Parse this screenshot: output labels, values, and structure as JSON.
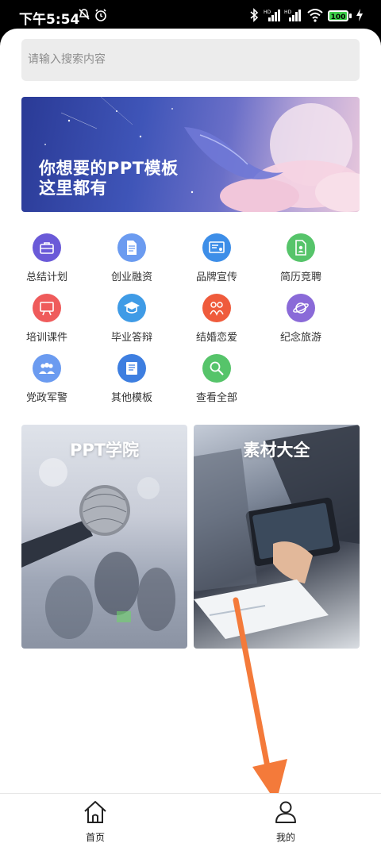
{
  "status_bar": {
    "time": "下午5:54",
    "battery": "100",
    "icons": [
      "mute-icon",
      "alarm-icon",
      "bluetooth-icon",
      "signal-icon",
      "signal-icon",
      "wifi-icon",
      "battery-icon",
      "charging-icon"
    ]
  },
  "search": {
    "placeholder": "请输入搜索内容"
  },
  "banner": {
    "title": "你想要的PPT模板\n这里都有"
  },
  "categories": [
    {
      "label": "总结计划",
      "icon": "briefcase-icon",
      "color": "#6a5ad8"
    },
    {
      "label": "创业融资",
      "icon": "document-icon",
      "color": "#6b9bf0"
    },
    {
      "label": "品牌宣传",
      "icon": "certificate-icon",
      "color": "#3d8ee8"
    },
    {
      "label": "简历竞聘",
      "icon": "resume-icon",
      "color": "#56c46a"
    },
    {
      "label": "培训课件",
      "icon": "presentation-icon",
      "color": "#ef5b5b"
    },
    {
      "label": "毕业答辩",
      "icon": "graduation-cap-icon",
      "color": "#3f9be6"
    },
    {
      "label": "结婚恋爱",
      "icon": "heart-couple-icon",
      "color": "#ef5b3c"
    },
    {
      "label": "纪念旅游",
      "icon": "planet-icon",
      "color": "#8a6ad8"
    },
    {
      "label": "党政军警",
      "icon": "group-icon",
      "color": "#6b9bf0"
    },
    {
      "label": "其他模板",
      "icon": "book-icon",
      "color": "#3d7ee0"
    },
    {
      "label": "查看全部",
      "icon": "search-icon",
      "color": "#56c46a"
    }
  ],
  "cards": [
    {
      "title": "PPT学院"
    },
    {
      "title": "素材大全"
    }
  ],
  "bottom_nav": [
    {
      "label": "首页",
      "icon": "home-icon"
    },
    {
      "label": "我的",
      "icon": "user-icon"
    }
  ],
  "colors": {
    "accent_arrow": "#f47a3a"
  }
}
